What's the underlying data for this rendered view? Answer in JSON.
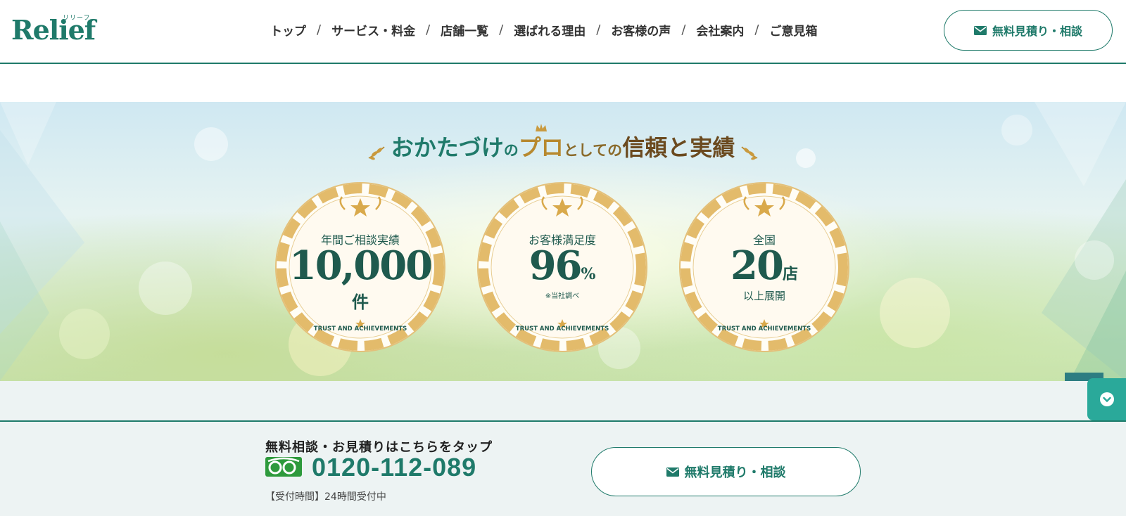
{
  "header": {
    "logo_text": "Relief",
    "logo_kana": "リリーフ",
    "nav": [
      {
        "label": "トップ"
      },
      {
        "label": "サービス・料金"
      },
      {
        "label": "店舗一覧"
      },
      {
        "label": "選ばれる理由"
      },
      {
        "label": "お客様の声"
      },
      {
        "label": "会社案内"
      },
      {
        "label": "ご意見箱"
      }
    ],
    "nav_separator": "/",
    "cta_label": "無料見積り・相談"
  },
  "hero": {
    "title_part1": "おかたづけ",
    "title_part2": "の",
    "title_part3": "プロ",
    "title_part4": "としての",
    "title_part5": "信頼と実績",
    "medals": [
      {
        "label": "年間ご相談実績",
        "value": "10,000",
        "unit": "",
        "sub": "件",
        "note": "",
        "ring_text": "TRUST AND ACHIEVEMENTS"
      },
      {
        "label": "お客様満足度",
        "value": "96",
        "unit": "%",
        "sub": "",
        "note": "※当社調べ",
        "ring_text": "TRUST AND ACHIEVEMENTS"
      },
      {
        "label": "全国",
        "value": "20",
        "unit": "店",
        "sub": "以上展開",
        "note": "",
        "ring_text": "TRUST AND ACHIEVEMENTS"
      }
    ]
  },
  "footer_bar": {
    "lead": "無料相談・お見積りはこちらをタップ",
    "phone": "0120-112-089",
    "hours": "【受付時間】24時間受付中",
    "cta_label": "無料見積り・相談"
  },
  "colors": {
    "brand": "#1f7a6a",
    "gold": "#b7892f",
    "pagetop": "#2d7d82",
    "side_tab": "#2aa99a"
  },
  "icons": {
    "mail": "mail-icon",
    "pagetop": "arrow-up-icon",
    "side_tab": "chevron-down-icon",
    "free_dial": "free-dial-icon"
  }
}
